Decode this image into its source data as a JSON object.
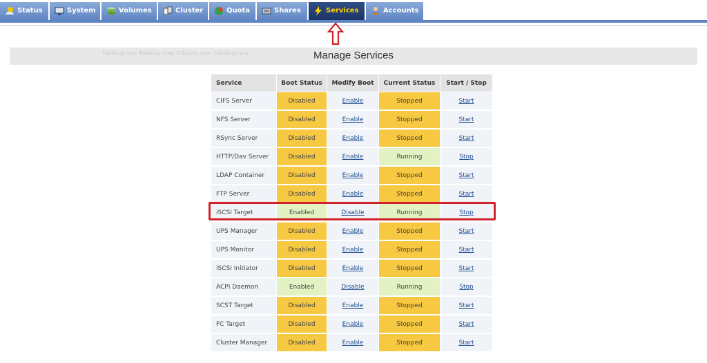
{
  "nav": {
    "tabs": [
      {
        "label": "Status",
        "icon": "status-icon",
        "active": false
      },
      {
        "label": "System",
        "icon": "system-icon",
        "active": false
      },
      {
        "label": "Volumes",
        "icon": "volumes-icon",
        "active": false
      },
      {
        "label": "Cluster",
        "icon": "cluster-icon",
        "active": false
      },
      {
        "label": "Quota",
        "icon": "quota-icon",
        "active": false
      },
      {
        "label": "Shares",
        "icon": "shares-icon",
        "active": false
      },
      {
        "label": "Services",
        "icon": "services-icon",
        "active": true
      },
      {
        "label": "Accounts",
        "icon": "accounts-icon",
        "active": false
      }
    ]
  },
  "watermark": "Tekbloq.com Tekbloq.com    Tekbloq.com  Tekbloq.com",
  "page_title": "Manage Services",
  "table": {
    "headers": {
      "service": "Service",
      "boot_status": "Boot Status",
      "modify_boot": "Modify Boot",
      "current_status": "Current Status",
      "start_stop": "Start / Stop"
    },
    "rows": [
      {
        "service": "CIFS Server",
        "boot": "Disabled",
        "modify": "Enable",
        "current": "Stopped",
        "action": "Start"
      },
      {
        "service": "NFS Server",
        "boot": "Disabled",
        "modify": "Enable",
        "current": "Stopped",
        "action": "Start"
      },
      {
        "service": "RSync Server",
        "boot": "Disabled",
        "modify": "Enable",
        "current": "Stopped",
        "action": "Start"
      },
      {
        "service": "HTTP/Dav Server",
        "boot": "Disabled",
        "modify": "Enable",
        "current": "Running",
        "action": "Stop"
      },
      {
        "service": "LDAP Container",
        "boot": "Disabled",
        "modify": "Enable",
        "current": "Stopped",
        "action": "Start"
      },
      {
        "service": "FTP Server",
        "boot": "Disabled",
        "modify": "Enable",
        "current": "Stopped",
        "action": "Start"
      },
      {
        "service": "iSCSI Target",
        "boot": "Enabled",
        "modify": "Disable",
        "current": "Running",
        "action": "Stop"
      },
      {
        "service": "UPS Manager",
        "boot": "Disabled",
        "modify": "Enable",
        "current": "Stopped",
        "action": "Start"
      },
      {
        "service": "UPS Monitor",
        "boot": "Disabled",
        "modify": "Enable",
        "current": "Stopped",
        "action": "Start"
      },
      {
        "service": "iSCSI Initiator",
        "boot": "Disabled",
        "modify": "Enable",
        "current": "Stopped",
        "action": "Start"
      },
      {
        "service": "ACPI Daemon",
        "boot": "Enabled",
        "modify": "Disable",
        "current": "Running",
        "action": "Stop"
      },
      {
        "service": "SCST Target",
        "boot": "Disabled",
        "modify": "Enable",
        "current": "Stopped",
        "action": "Start"
      },
      {
        "service": "FC Target",
        "boot": "Disabled",
        "modify": "Enable",
        "current": "Stopped",
        "action": "Start"
      },
      {
        "service": "Cluster Manager",
        "boot": "Disabled",
        "modify": "Enable",
        "current": "Stopped",
        "action": "Start"
      }
    ]
  },
  "colors": {
    "tab": "#5f85c3",
    "tab_active": "#1c3566",
    "tab_active_text": "#ffd200",
    "status_off": "#f7c842",
    "status_on": "#e2f2c2",
    "annotation": "#d0232b"
  }
}
